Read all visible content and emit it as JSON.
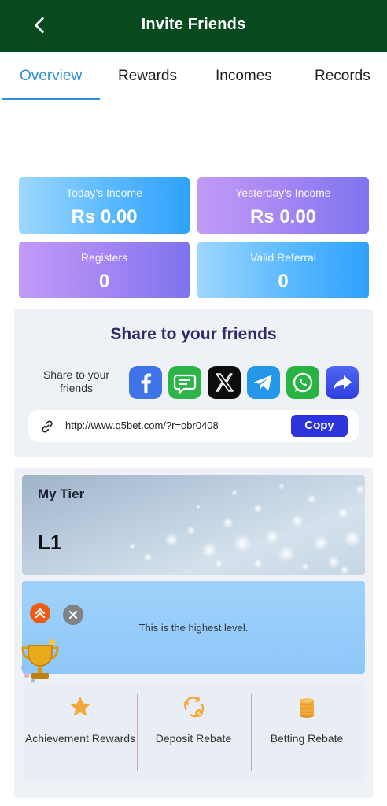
{
  "header": {
    "title": "Invite Friends"
  },
  "tabs": [
    {
      "label": "Overview",
      "active": true
    },
    {
      "label": "Rewards"
    },
    {
      "label": "Incomes"
    },
    {
      "label": "Records"
    }
  ],
  "stats": {
    "today_income": {
      "label": "Today's Income",
      "value": "Rs 0.00"
    },
    "yesterday_income": {
      "label": "Yesterday's Income",
      "value": "Rs 0.00"
    },
    "registers": {
      "label": "Registers",
      "value": "0"
    },
    "valid_referral": {
      "label": "Valid Referral",
      "value": "0"
    }
  },
  "share": {
    "title": "Share to your friends",
    "subtitle": "Share to your friends",
    "platforms": [
      "facebook",
      "sms",
      "x",
      "telegram",
      "whatsapp",
      "share"
    ],
    "link": "http://www.q5bet.com/?r=obr0408",
    "copy_label": "Copy"
  },
  "tier": {
    "title": "My Tier",
    "level": "L1",
    "message": "This is the highest level."
  },
  "rebates": [
    {
      "label": "Achievement Rewards",
      "icon": "star-icon"
    },
    {
      "label": "Deposit Rebate",
      "icon": "deposit-rebate-icon"
    },
    {
      "label": "Betting Rebate",
      "icon": "coin-stack-icon"
    }
  ],
  "colors": {
    "header_bg": "#074a1e",
    "active_tab": "#2f8fd8",
    "copy_button": "#2d34dc",
    "title_text": "#2e2a6b"
  }
}
